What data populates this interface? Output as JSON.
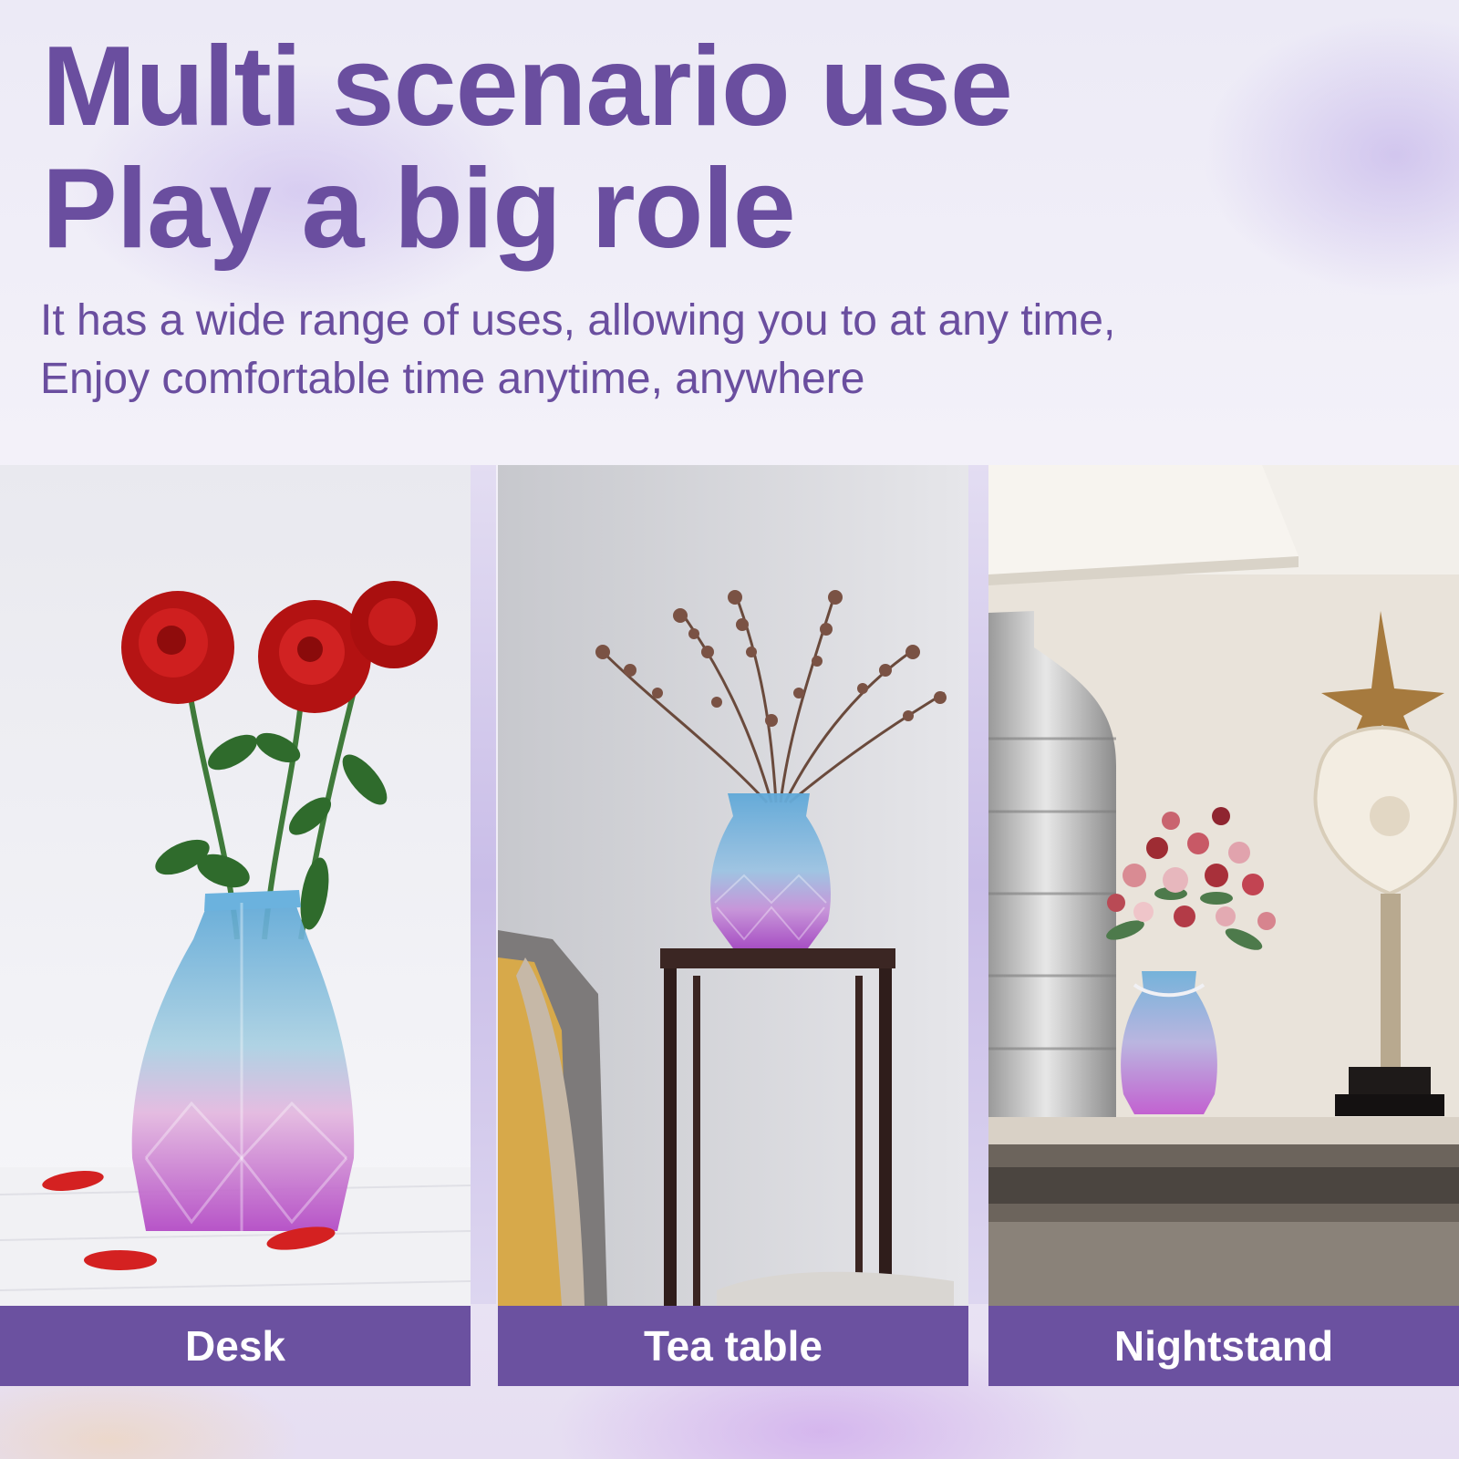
{
  "headline": {
    "line1": "Multi scenario use",
    "line2": "Play a big role"
  },
  "subtitle": {
    "line1": "It has a wide range of uses, allowing you to at any time,",
    "line2": "Enjoy comfortable time anytime, anywhere"
  },
  "scenes": [
    {
      "label": "Desk"
    },
    {
      "label": "Tea table"
    },
    {
      "label": "Nightstand"
    }
  ],
  "colors": {
    "brand_purple": "#6a4e9f",
    "label_bar": "#6b51a0",
    "label_text": "#ffffff"
  }
}
